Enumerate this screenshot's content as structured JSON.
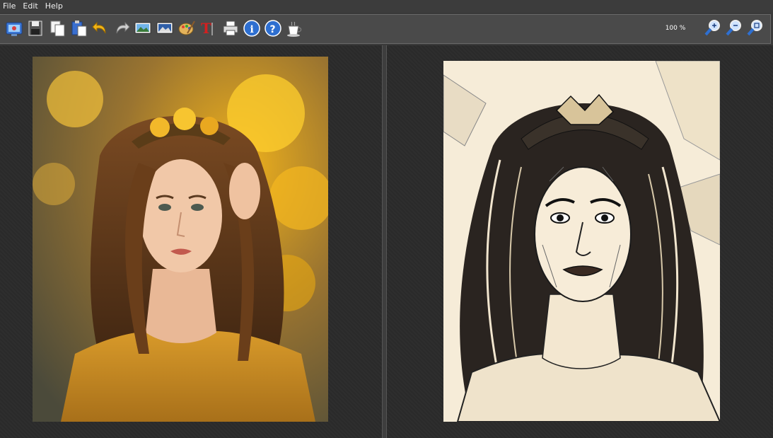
{
  "menu": {
    "file": "File",
    "edit": "Edit",
    "help": "Help"
  },
  "toolbar": {
    "icons": [
      "open-image-icon",
      "save-icon",
      "copy-icon",
      "paste-icon",
      "undo-icon",
      "redo-icon",
      "show-original-icon",
      "show-result-icon",
      "settings-palette-icon",
      "text-tool-icon",
      "print-icon",
      "info-icon",
      "help-icon",
      "coffee-donate-icon",
      "zoom-in-icon",
      "zoom-out-icon",
      "zoom-fit-icon"
    ],
    "zoom_level": "100 %"
  },
  "panels": {
    "original": "photo of a young woman with long wavy hair wearing a yellow flower crown and mustard off-shoulder dress against autumn leaves",
    "result": "pencil sketch rendering of the same woman in black ink on cream paper"
  },
  "colors": {
    "background": "#2a2a2a",
    "toolbar": "#4a4a4a",
    "menubar": "#3c3c3c",
    "accent_blue": "#2e6fd0",
    "accent_yellow": "#e0a818"
  }
}
